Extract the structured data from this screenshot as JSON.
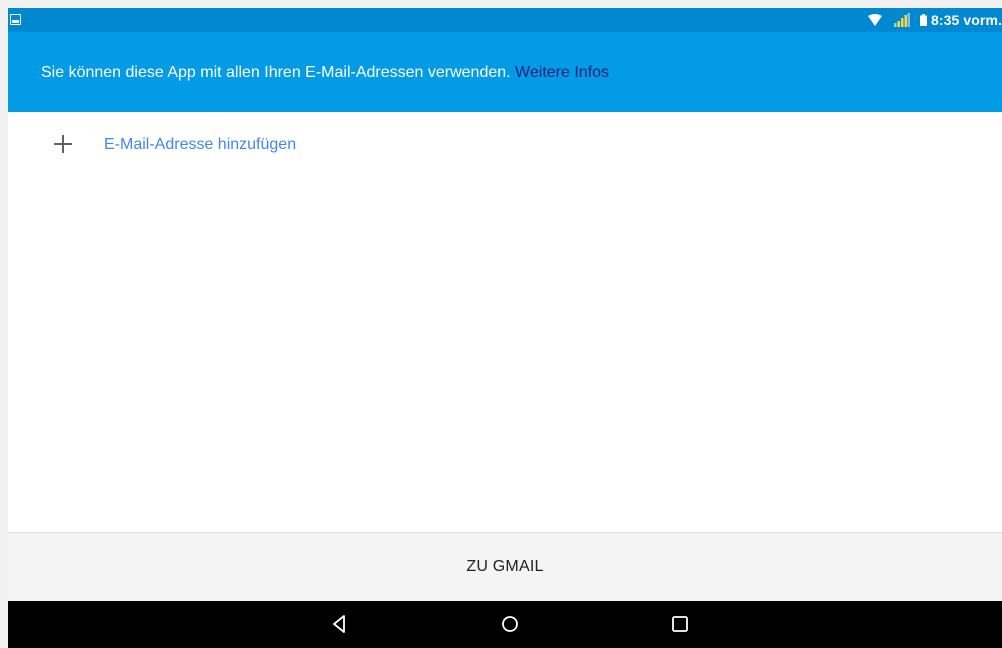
{
  "status_bar": {
    "time": "8:35 vorm.",
    "icons": [
      "gallery-icon",
      "wifi-icon",
      "signal-icon",
      "battery-icon"
    ]
  },
  "banner": {
    "text": "Sie können diese App mit allen Ihren E-Mail-Adressen verwenden. ",
    "link_label": "Weitere Infos",
    "background_color": "#039be5",
    "link_color": "#1a237e"
  },
  "add_email": {
    "label": "E-Mail-Adresse hinzufügen",
    "icon": "plus-icon",
    "color": "#4285f4"
  },
  "bottom_action": {
    "label": "ZU GMAIL"
  },
  "nav_bar": {
    "buttons": [
      "back-icon",
      "home-icon",
      "recents-icon"
    ]
  }
}
